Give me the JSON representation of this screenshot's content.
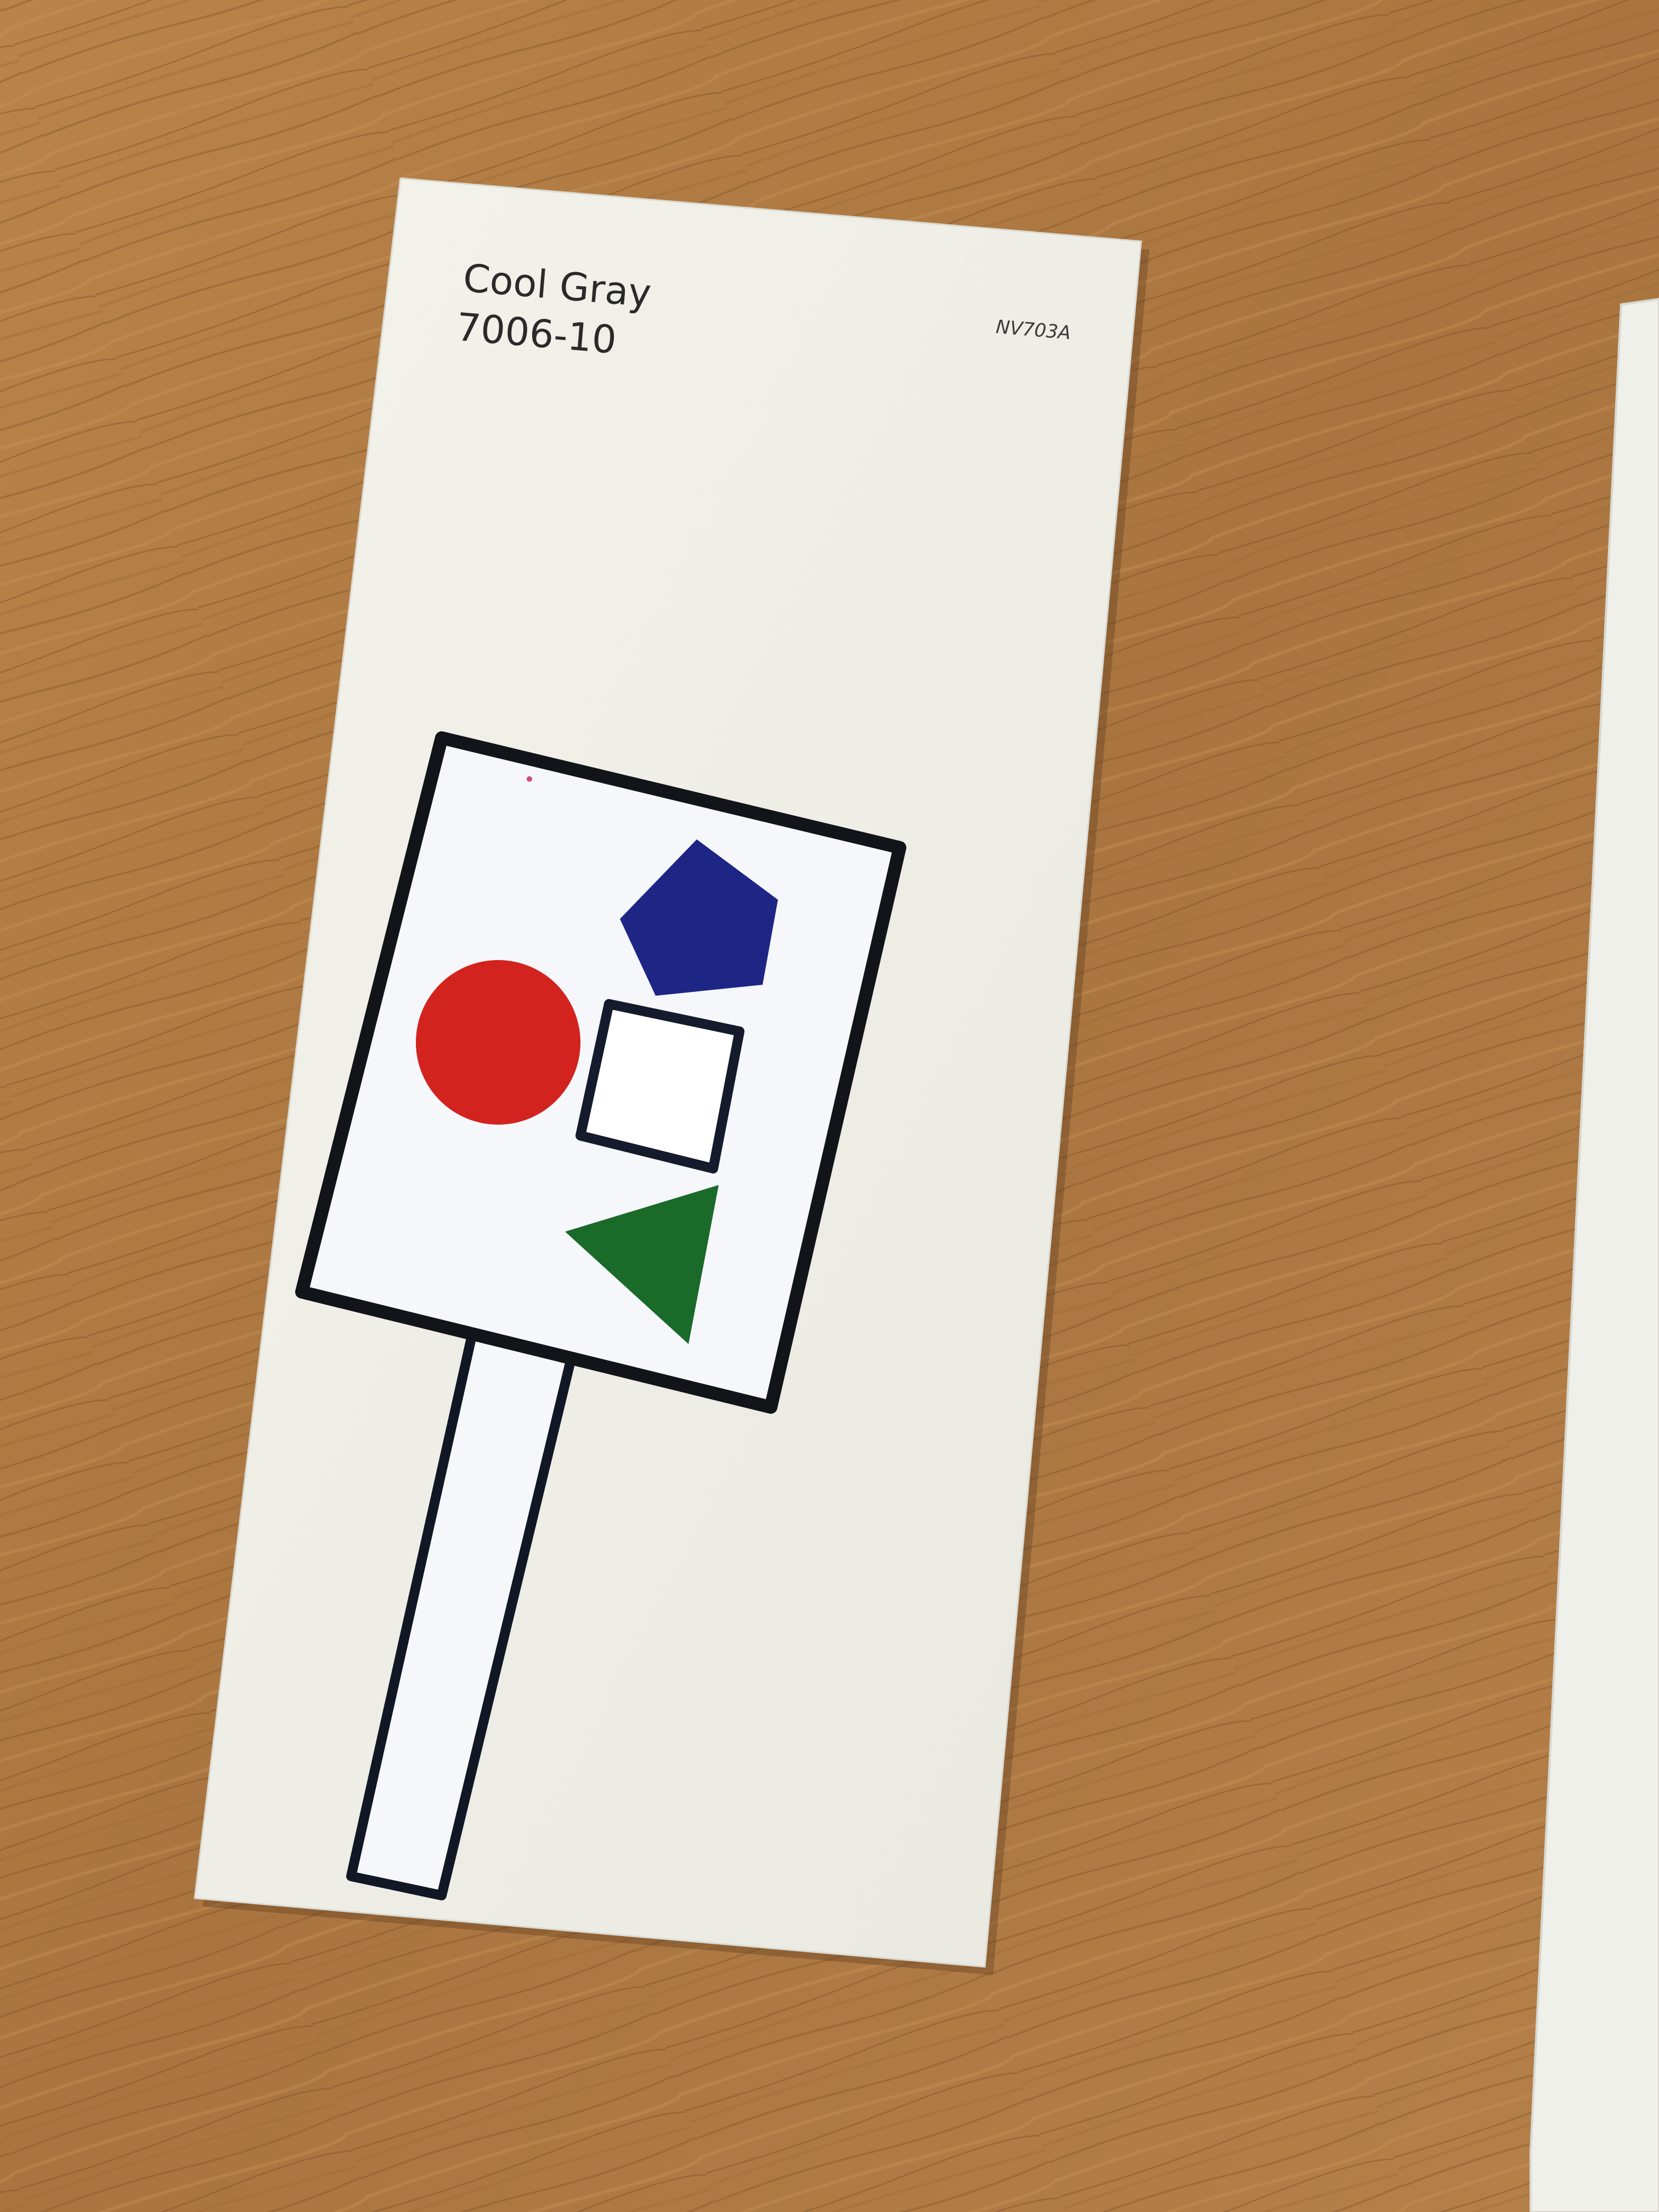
{
  "paint_card": {
    "color_name": "Cool Gray",
    "color_number": "7006-10",
    "code": "NV703A"
  },
  "colors": {
    "table_wood": "#b07a44",
    "card": "#f1f1ea",
    "cutout_paper": "#f6f7fb",
    "outline": "#111418",
    "circle": "#d2231f",
    "pentagon": "#1d2585",
    "triangle": "#1a6a2a"
  },
  "shapes": [
    {
      "kind": "circle",
      "color": "red",
      "icon": "circle-icon"
    },
    {
      "kind": "pentagon",
      "color": "blue",
      "icon": "pentagon-icon"
    },
    {
      "kind": "square",
      "color": "outline",
      "icon": "square-outline-icon"
    },
    {
      "kind": "triangle",
      "color": "green",
      "icon": "triangle-icon"
    }
  ]
}
